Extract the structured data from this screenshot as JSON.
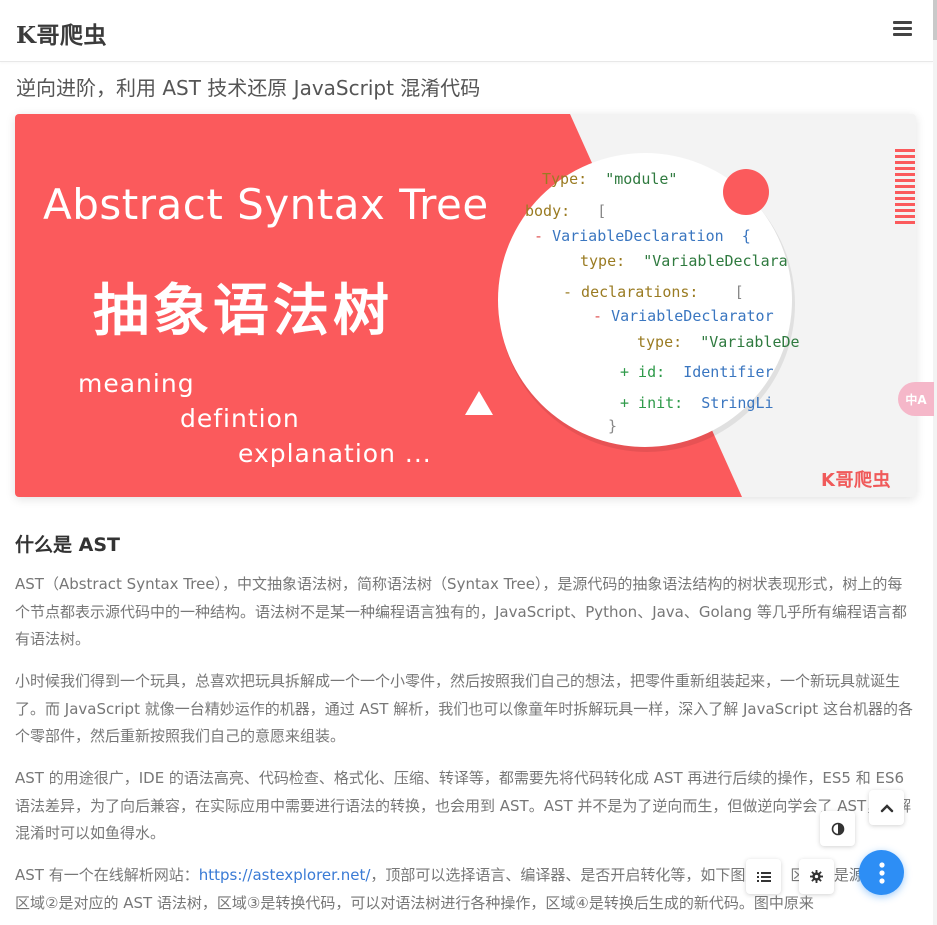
{
  "site": {
    "logo": "K哥爬虫"
  },
  "post": {
    "title": "逆向进阶，利用 AST 技术还原 JavaScript 混淆代码"
  },
  "banner": {
    "title_en": "Abstract Syntax Tree",
    "title_cn": "抽象语法树",
    "words": [
      "meaning",
      "defintion",
      "explanation ..."
    ],
    "watermark": "K哥爬虫",
    "accent_color": "#fb5a5c",
    "code_lines": [
      {
        "k": "Type:",
        "v": "\"module\""
      },
      {
        "k": "body:",
        "v": "["
      },
      {
        "k": "- ",
        "v": "VariableDeclaration  {"
      },
      {
        "k": "type:",
        "v": "\"VariableDeclara"
      },
      {
        "k": "- declarations:",
        "v": "["
      },
      {
        "k": "- ",
        "v": "VariableDeclarator"
      },
      {
        "k": "type:",
        "v": "\"VariableDe"
      },
      {
        "k": "+ id:",
        "v": "Identifier"
      },
      {
        "k": "+ init:",
        "v": "StringLi"
      },
      {
        "k": "",
        "v": "}"
      }
    ]
  },
  "article": {
    "heading": "什么是 AST",
    "p1": "AST（Abstract Syntax Tree），中文抽象语法树，简称语法树（Syntax Tree），是源代码的抽象语法结构的树状表现形式，树上的每个节点都表示源代码中的一种结构。语法树不是某一种编程语言独有的，JavaScript、Python、Java、Golang 等几乎所有编程语言都有语法树。",
    "p2": "小时候我们得到一个玩具，总喜欢把玩具拆解成一个一个小零件，然后按照我们自己的想法，把零件重新组装起来，一个新玩具就诞生了。而 JavaScript 就像一台精妙运作的机器，通过 AST 解析，我们也可以像童年时拆解玩具一样，深入了解 JavaScript 这台机器的各个零部件，然后重新按照我们自己的意愿来组装。",
    "p3": "AST 的用途很广，IDE 的语法高亮、代码检查、格式化、压缩、转译等，都需要先将代码转化成 AST 再进行后续的操作，ES5 和 ES6 语法差异，为了向后兼容，在实际应用中需要进行语法的转换，也会用到 AST。AST 并不是为了逆向而生，但做逆向学会了 AST，在解混淆时可以如鱼得水。",
    "p4_before": "AST 有一个在线解析网站：",
    "p4_link": "https://astexplorer.net/",
    "p4_after": "，顶部可以选择语言、编译器、是否开启转化等，如下图所示，区域①是源代码，区域②是对应的 AST 语法树，区域③是转换代码，可以对语法树进行各种操作，区域④是转换后生成的新代码。图中原来"
  },
  "ui": {
    "translate_label": "中A",
    "fab_color": "#2d8ef5"
  }
}
